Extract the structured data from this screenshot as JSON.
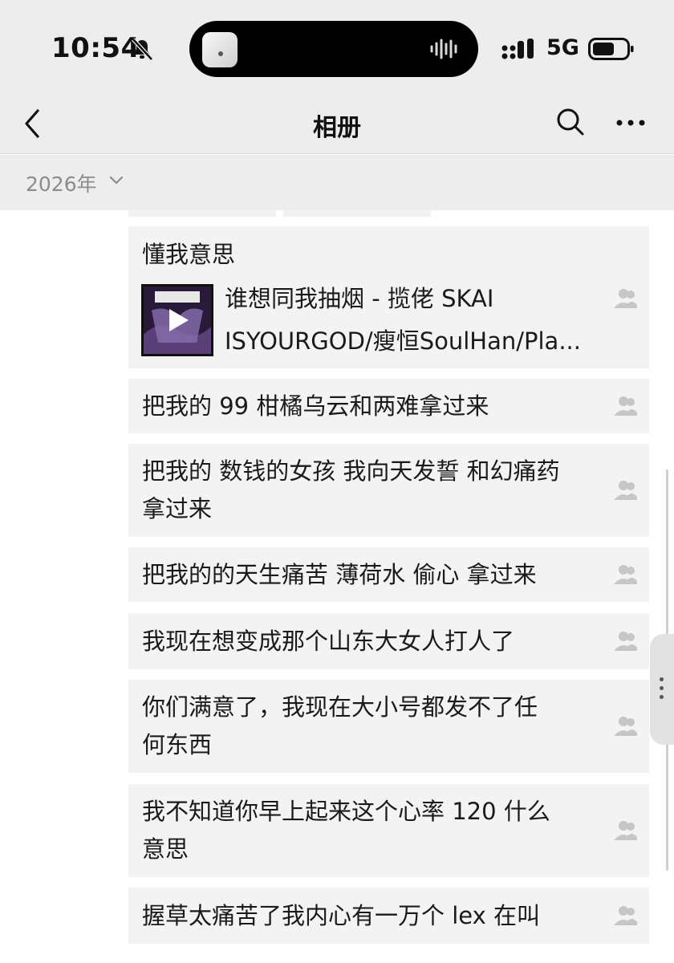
{
  "status_bar": {
    "time": "10:54",
    "network": "5G",
    "icons": [
      "bell-slash-icon",
      "cellular-signal-icon",
      "battery-icon"
    ]
  },
  "nav": {
    "title": "相册",
    "icons": [
      "chevron-left-icon",
      "search-icon",
      "more-icon"
    ]
  },
  "year_filter": {
    "label": "2026年"
  },
  "posts": [
    {
      "text": "懂我意思",
      "music": {
        "line1": "谁想同我抽烟 - 揽佬 SKAI",
        "line2": "ISYOURGOD/瘦恒SoulHan/Pla..."
      }
    },
    {
      "text": "把我的 99 柑橘乌云和两难拿过来"
    },
    {
      "line1": "把我的 数钱的女孩 我向天发誓 和幻痛药",
      "line2": "拿过来"
    },
    {
      "text": "把我的的天生痛苦 薄荷水 偷心 拿过来"
    },
    {
      "text": "我现在想变成那个山东大女人打人了"
    },
    {
      "line1": "你们满意了，我现在大小号都发不了任",
      "line2": "何东西"
    },
    {
      "line1": "我不知道你早上起来这个心率 120 什么",
      "line2": "意思"
    },
    {
      "text": "握草太痛苦了我内心有一万个 lex 在叫"
    }
  ],
  "colors": {
    "bar_bg": "#ededed",
    "card_bg": "#f3f3f3",
    "muted": "#8c8c8c"
  }
}
